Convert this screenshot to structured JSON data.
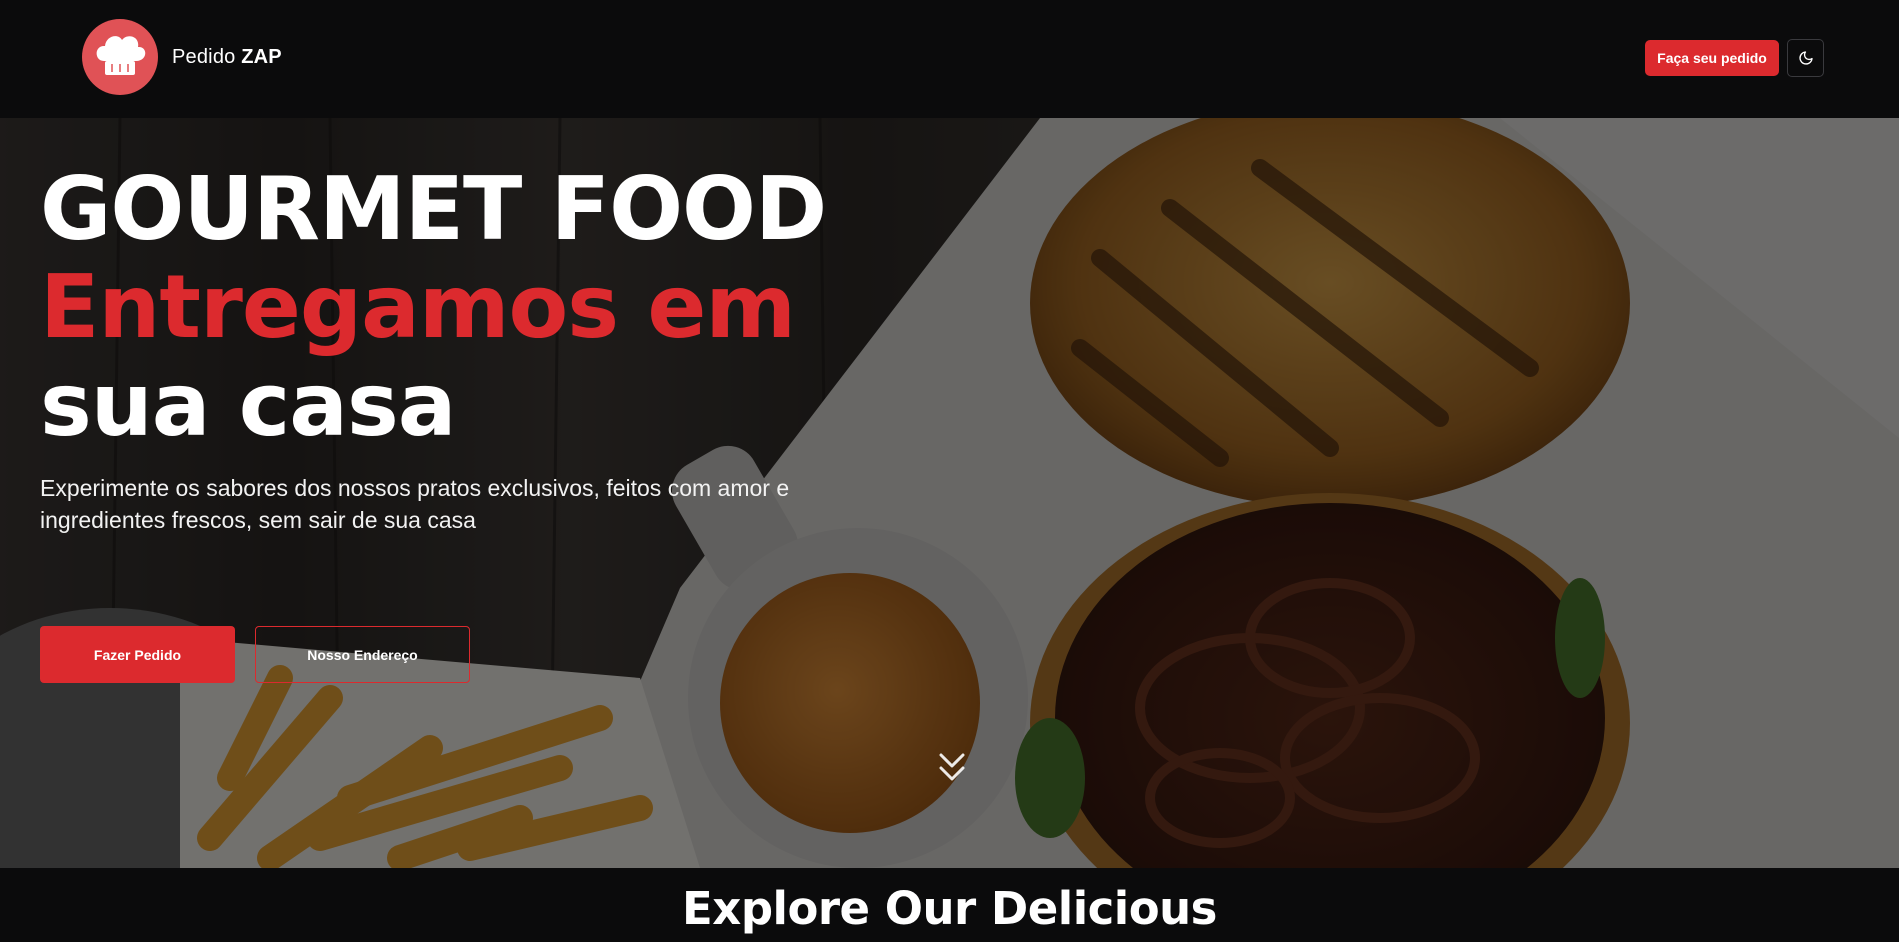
{
  "navbar": {
    "brand_prefix": "Pedido",
    "brand_suffix": "ZAP",
    "order_button": "Faça seu pedido",
    "theme_toggle_icon": "moon-icon"
  },
  "hero": {
    "title_line1": "GOURMET FOOD",
    "title_line2": "Entregamos em",
    "title_line3": "sua casa",
    "subtitle": "Experimente os sabores dos nossos pratos exclusivos, feitos com amor e ingredientes frescos, sem sair de sua casa",
    "primary_button": "Fazer Pedido",
    "secondary_button": "Nosso Endereço",
    "scroll_icon": "chevrons-down-icon"
  },
  "explore": {
    "title": "Explore Our Delicious"
  },
  "colors": {
    "accent": "#dc2a2e",
    "background": "#0b0b0c",
    "logo": "#e05256",
    "text": "#ffffff"
  }
}
